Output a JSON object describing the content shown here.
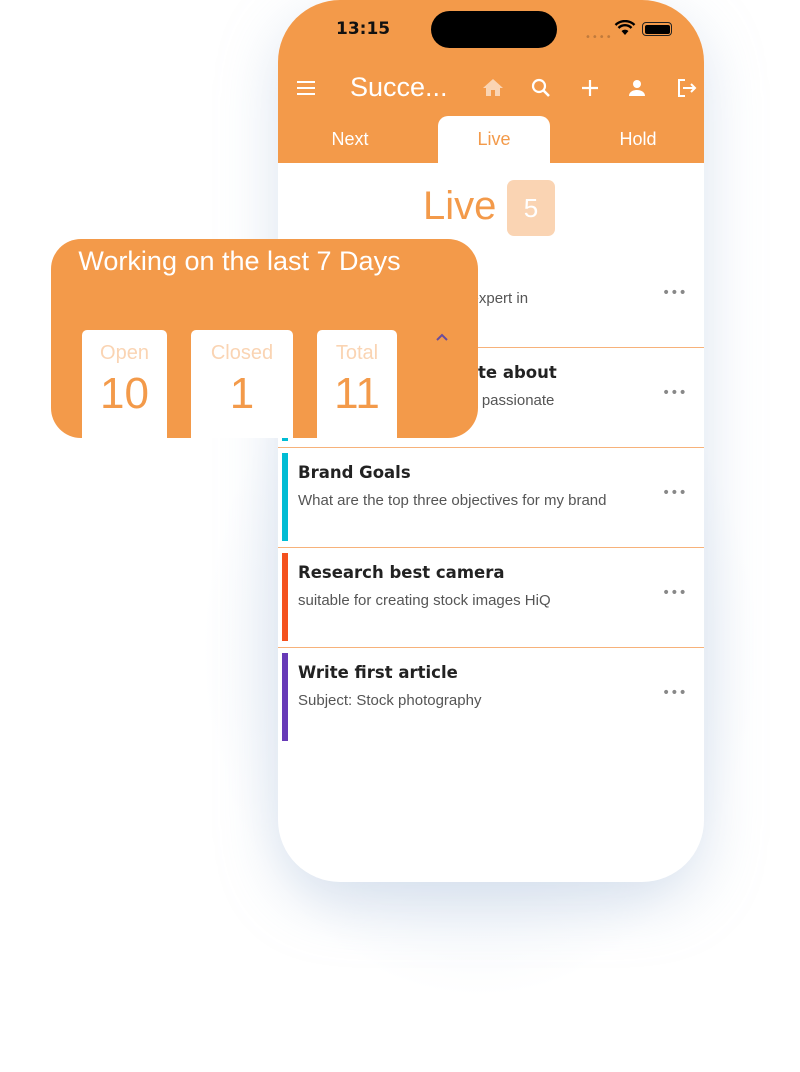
{
  "status_bar": {
    "time": "13:15"
  },
  "app_bar": {
    "title": "Succe...",
    "icons": [
      "menu-icon",
      "home-icon",
      "search-icon",
      "plus-icon",
      "person-icon",
      "logout-icon"
    ]
  },
  "tabs": [
    {
      "label": "Next"
    },
    {
      "label": "Live",
      "active": true
    },
    {
      "label": "Hold"
    }
  ],
  "section": {
    "title": "Live",
    "count": "5"
  },
  "tasks": [
    {
      "title": "",
      "subtitle": "n expert in",
      "color": "#00BCD4"
    },
    {
      "title": "te about",
      "subtitle": "st passionate",
      "color": "#00BCD4"
    },
    {
      "title": "Brand Goals",
      "subtitle": "What are the top three objectives for my brand",
      "color": "#00BCD4"
    },
    {
      "title": "Research best camera",
      "subtitle": "suitable for creating stock images HiQ",
      "color": "#F4511E"
    },
    {
      "title": "Write first article",
      "subtitle": "Subject: Stock photography",
      "color": "#673AB7"
    }
  ],
  "summary": {
    "title": "Working on the last 7 Days",
    "stats": [
      {
        "label": "Open",
        "value": "10"
      },
      {
        "label": "Closed",
        "value": "1"
      },
      {
        "label": "Total",
        "value": "11"
      }
    ]
  },
  "colors": {
    "accent": "#F39A4A",
    "accent_light": "#FAD4B3"
  }
}
